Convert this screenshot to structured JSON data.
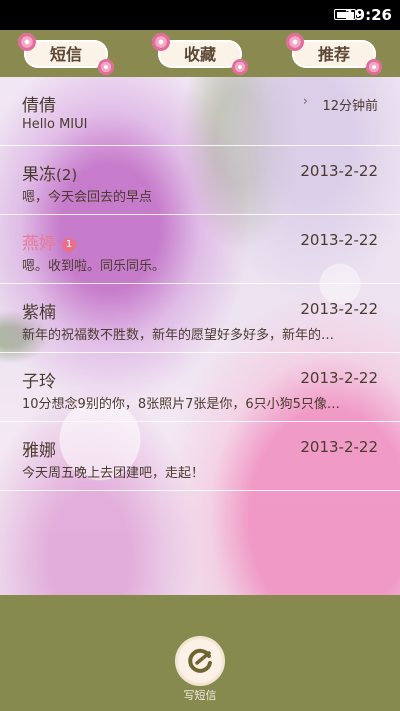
{
  "status_bar": {
    "time": "19:26",
    "battery_icon": "battery-full-icon"
  },
  "tabs": [
    {
      "label": "短信"
    },
    {
      "label": "收藏"
    },
    {
      "label": "推荐"
    }
  ],
  "messages": [
    {
      "name": "倩倩",
      "count": "",
      "badge": "",
      "date": "12分钟前",
      "preview": "Hello MIUI",
      "unread": false
    },
    {
      "name": "果冻",
      "count": "(2)",
      "badge": "",
      "date": "2013-2-22",
      "preview": "嗯，今天会回去的早点",
      "unread": false
    },
    {
      "name": "燕婷",
      "count": "",
      "badge": "1",
      "date": "2013-2-22",
      "preview": "嗯。收到啦。同乐同乐。",
      "unread": true
    },
    {
      "name": "紫楠",
      "count": "",
      "badge": "",
      "date": "2013-2-22",
      "preview": "新年的祝福数不胜数，新年的愿望好多好多，新年的…",
      "unread": false
    },
    {
      "name": "子玲",
      "count": "",
      "badge": "",
      "date": "2013-2-22",
      "preview": "10分想念9别的你，8张照片7张是你，6只小狗5只像…",
      "unread": false
    },
    {
      "name": "雅娜",
      "count": "",
      "badge": "",
      "date": "2013-2-22",
      "preview": "今天周五晚上去团建吧，走起！",
      "unread": false
    }
  ],
  "compose": {
    "label": "写短信",
    "icon": "compose-icon"
  },
  "colors": {
    "bar": "#878a4e",
    "unread_name": "#e87a93",
    "badge": "#e8708a",
    "text": "#4a3b30"
  }
}
